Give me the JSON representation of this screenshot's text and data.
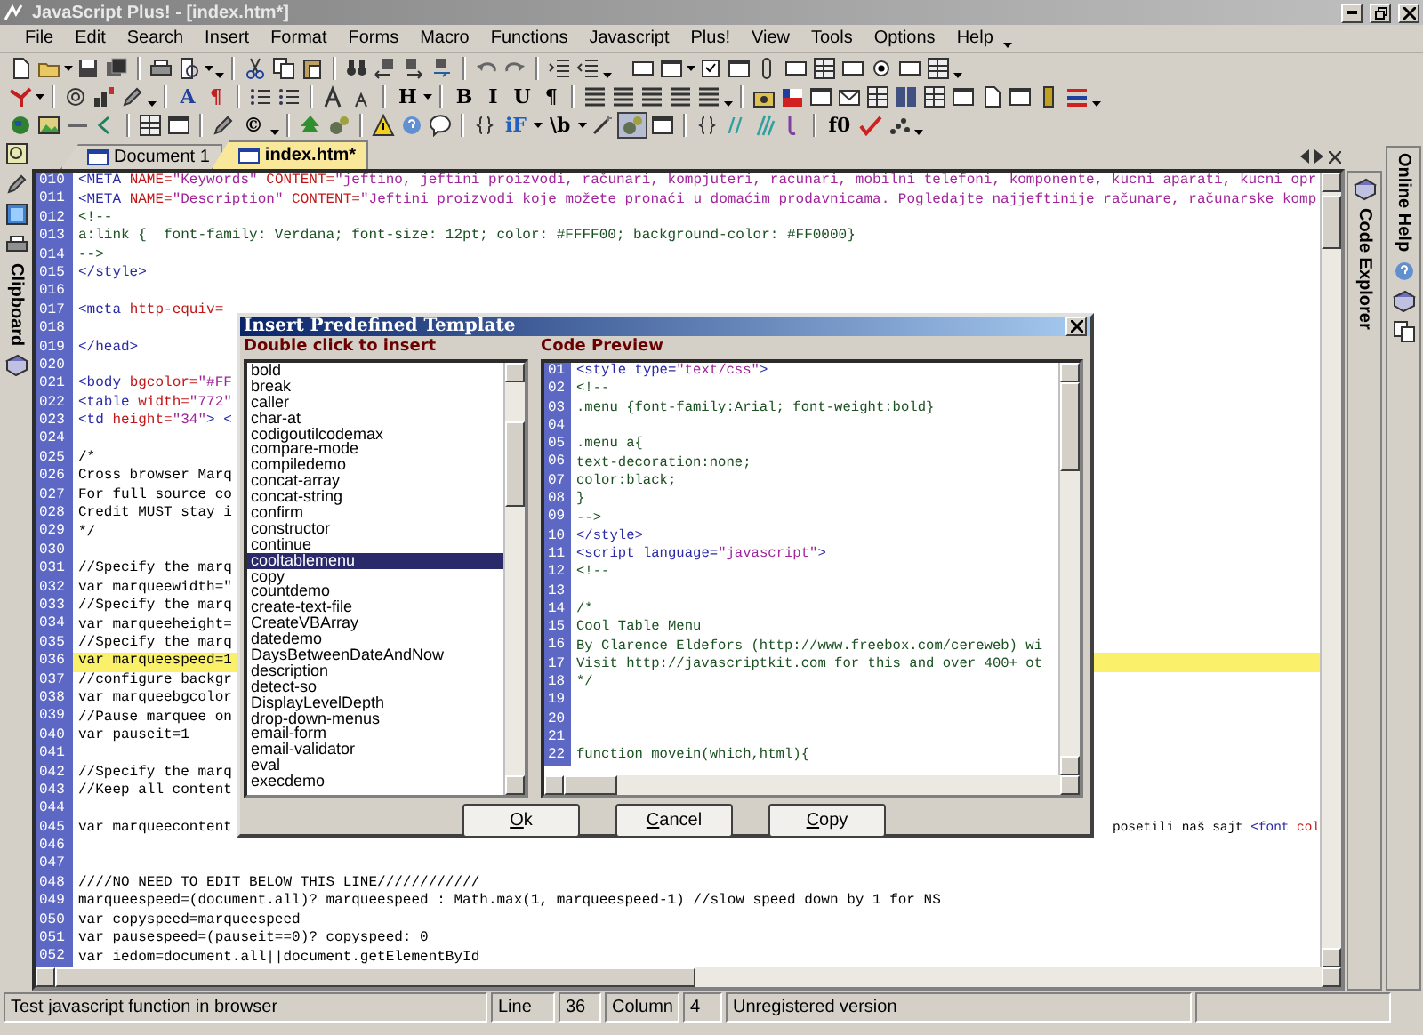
{
  "window": {
    "title": "JavaScript Plus! - [index.htm*]"
  },
  "menu": [
    "File",
    "Edit",
    "Search",
    "Insert",
    "Format",
    "Forms",
    "Macro",
    "Functions",
    "Javascript",
    "Plus!",
    "View",
    "Tools",
    "Options",
    "Help"
  ],
  "toolbars": [
    {
      "labels": [
        "A",
        "¶",
        "H",
        "B",
        "I",
        "U",
        "¶"
      ]
    },
    {
      "labels": [
        "©",
        "iF",
        "\\b",
        "//",
        "f0"
      ]
    }
  ],
  "left_dock": {
    "label": "Clipboard"
  },
  "right_dock": [
    {
      "label": "Code Explorer"
    },
    {
      "label": "Online Help"
    }
  ],
  "tabs": [
    {
      "label": "Document 1",
      "selected": false
    },
    {
      "label": "index.htm*",
      "selected": true
    }
  ],
  "editor": {
    "lines": [
      {
        "number": "010",
        "highlighted": false,
        "segments": [
          {
            "kind": "tag",
            "text": "<META "
          },
          {
            "kind": "attr",
            "text": "NAME="
          },
          {
            "kind": "string",
            "text": "\"Keywords\""
          },
          {
            "kind": "attr",
            "text": " CONTENT="
          },
          {
            "kind": "string",
            "text": "\"jeftino, jeftini proizvodi, računari, kompjuteri, racunari, mobilni telefoni, komponente, kucni aparati, kucni opr"
          }
        ]
      },
      {
        "number": "011",
        "highlighted": false,
        "segments": [
          {
            "kind": "tag",
            "text": "<META "
          },
          {
            "kind": "attr",
            "text": "NAME="
          },
          {
            "kind": "string",
            "text": "\"Description\""
          },
          {
            "kind": "attr",
            "text": " CONTENT="
          },
          {
            "kind": "string",
            "text": "\"Jeftini proizvodi koje možete pronaći u domaćim prodavnicama. Pogledajte najjeftinije računare, računarske komp"
          }
        ]
      },
      {
        "number": "012",
        "highlighted": false,
        "segments": [
          {
            "kind": "css",
            "text": "<!--"
          }
        ]
      },
      {
        "number": "013",
        "highlighted": false,
        "segments": [
          {
            "kind": "css",
            "text": "a:link {  font-family: Verdana; font-size: 12pt; color: #FFFF00; background-color: #FF0000}"
          }
        ]
      },
      {
        "number": "014",
        "highlighted": false,
        "segments": [
          {
            "kind": "css",
            "text": "-->"
          }
        ]
      },
      {
        "number": "015",
        "highlighted": false,
        "segments": [
          {
            "kind": "tag",
            "text": "</style>"
          }
        ]
      },
      {
        "number": "016",
        "highlighted": false
      },
      {
        "number": "017",
        "highlighted": false,
        "segments": [
          {
            "kind": "tag",
            "text": "<meta "
          },
          {
            "kind": "attr",
            "text": "http-equiv="
          }
        ]
      },
      {
        "number": "018",
        "highlighted": false
      },
      {
        "number": "019",
        "highlighted": false,
        "segments": [
          {
            "kind": "tag",
            "text": "</head>"
          }
        ]
      },
      {
        "number": "020",
        "highlighted": false
      },
      {
        "number": "021",
        "highlighted": false,
        "segments": [
          {
            "kind": "tag",
            "text": "<body "
          },
          {
            "kind": "attr",
            "text": "bgcolor="
          },
          {
            "kind": "string",
            "text": "\"#FF"
          }
        ]
      },
      {
        "number": "022",
        "highlighted": false,
        "segments": [
          {
            "kind": "tag",
            "text": "<table "
          },
          {
            "kind": "attr",
            "text": "width="
          },
          {
            "kind": "string",
            "text": "\"772\""
          }
        ]
      },
      {
        "number": "023",
        "highlighted": false,
        "segments": [
          {
            "kind": "tag",
            "text": "<td "
          },
          {
            "kind": "attr",
            "text": "height="
          },
          {
            "kind": "string",
            "text": "\"34\""
          },
          {
            "kind": "tag",
            "text": "> <"
          }
        ]
      },
      {
        "number": "024",
        "highlighted": false
      },
      {
        "number": "025",
        "highlighted": false,
        "segments": [
          {
            "kind": "plain",
            "text": "/*"
          }
        ]
      },
      {
        "number": "026",
        "highlighted": false,
        "segments": [
          {
            "kind": "plain",
            "text": "Cross browser Marq"
          }
        ]
      },
      {
        "number": "027",
        "highlighted": false,
        "segments": [
          {
            "kind": "plain",
            "text": "For full source co"
          }
        ]
      },
      {
        "number": "028",
        "highlighted": false,
        "segments": [
          {
            "kind": "plain",
            "text": "Credit MUST stay i"
          }
        ]
      },
      {
        "number": "029",
        "highlighted": false,
        "segments": [
          {
            "kind": "plain",
            "text": "*/"
          }
        ]
      },
      {
        "number": "030",
        "highlighted": false
      },
      {
        "number": "031",
        "highlighted": false,
        "segments": [
          {
            "kind": "plain",
            "text": "//Specify the marq"
          }
        ]
      },
      {
        "number": "032",
        "highlighted": false,
        "segments": [
          {
            "kind": "plain",
            "text": "var marqueewidth=\""
          }
        ]
      },
      {
        "number": "033",
        "highlighted": false,
        "segments": [
          {
            "kind": "plain",
            "text": "//Specify the marq"
          }
        ]
      },
      {
        "number": "034",
        "highlighted": false,
        "segments": [
          {
            "kind": "plain",
            "text": "var marqueeheight="
          }
        ]
      },
      {
        "number": "035",
        "highlighted": false,
        "segments": [
          {
            "kind": "plain",
            "text": "//Specify the marq"
          }
        ]
      },
      {
        "number": "036",
        "highlighted": true,
        "segments": [
          {
            "kind": "plain",
            "text": "var marqueespeed=1"
          }
        ]
      },
      {
        "number": "037",
        "highlighted": false,
        "segments": [
          {
            "kind": "plain",
            "text": "//configure backgr"
          }
        ]
      },
      {
        "number": "038",
        "highlighted": false,
        "segments": [
          {
            "kind": "plain",
            "text": "var marqueebgcolor"
          }
        ]
      },
      {
        "number": "039",
        "highlighted": false,
        "segments": [
          {
            "kind": "plain",
            "text": "//Pause marquee on"
          }
        ]
      },
      {
        "number": "040",
        "highlighted": false,
        "segments": [
          {
            "kind": "plain",
            "text": "var pauseit=1"
          }
        ]
      },
      {
        "number": "041",
        "highlighted": false
      },
      {
        "number": "042",
        "highlighted": false,
        "segments": [
          {
            "kind": "plain",
            "text": "//Specify the marq"
          }
        ]
      },
      {
        "number": "043",
        "highlighted": false,
        "segments": [
          {
            "kind": "plain",
            "text": "//Keep all content"
          }
        ]
      },
      {
        "number": "044",
        "highlighted": false
      },
      {
        "number": "045",
        "highlighted": false,
        "segments": [
          {
            "kind": "plain",
            "text": "var marqueecontent"
          }
        ],
        "tail": [
          {
            "kind": "plain",
            "text": "posetili naš sajt "
          },
          {
            "kind": "tag",
            "text": "<font "
          },
          {
            "kind": "attr",
            "text": "col"
          }
        ]
      },
      {
        "number": "046",
        "highlighted": false
      },
      {
        "number": "047",
        "highlighted": false
      },
      {
        "number": "048",
        "highlighted": false,
        "segments": [
          {
            "kind": "plain",
            "text": "////NO NEED TO EDIT BELOW THIS LINE////////////"
          }
        ]
      },
      {
        "number": "049",
        "highlighted": false,
        "segments": [
          {
            "kind": "plain",
            "text": "marqueespeed=(document.all)? marqueespeed : Math.max(1, marqueespeed-1) //slow speed down by 1 for NS"
          }
        ]
      },
      {
        "number": "050",
        "highlighted": false,
        "segments": [
          {
            "kind": "plain",
            "text": "var copyspeed=marqueespeed"
          }
        ]
      },
      {
        "number": "051",
        "highlighted": false,
        "segments": [
          {
            "kind": "plain",
            "text": "var pausespeed=(pauseit==0)? copyspeed: 0"
          }
        ]
      },
      {
        "number": "052",
        "highlighted": false,
        "segments": [
          {
            "kind": "plain",
            "text": "var iedom=document.all||document.getElementById"
          }
        ]
      }
    ]
  },
  "dialog": {
    "title": "Insert Predefined Template",
    "list_label": "Double click to insert",
    "items": [
      {
        "label": "bold",
        "selected": false
      },
      {
        "label": "break",
        "selected": false
      },
      {
        "label": "caller",
        "selected": false
      },
      {
        "label": "char-at",
        "selected": false
      },
      {
        "label": "codigoutilcodemax",
        "selected": false
      },
      {
        "label": "compare-mode",
        "selected": false
      },
      {
        "label": "compiledemo",
        "selected": false
      },
      {
        "label": "concat-array",
        "selected": false
      },
      {
        "label": "concat-string",
        "selected": false
      },
      {
        "label": "confirm",
        "selected": false
      },
      {
        "label": "constructor",
        "selected": false
      },
      {
        "label": "continue",
        "selected": false
      },
      {
        "label": "cooltablemenu",
        "selected": true
      },
      {
        "label": "copy",
        "selected": false
      },
      {
        "label": "countdemo",
        "selected": false
      },
      {
        "label": "create-text-file",
        "selected": false
      },
      {
        "label": "CreateVBArray",
        "selected": false
      },
      {
        "label": "datedemo",
        "selected": false
      },
      {
        "label": "DaysBetweenDateAndNow",
        "selected": false
      },
      {
        "label": "description",
        "selected": false
      },
      {
        "label": "detect-so",
        "selected": false
      },
      {
        "label": "DisplayLevelDepth",
        "selected": false
      },
      {
        "label": "drop-down-menus",
        "selected": false
      },
      {
        "label": "email-form",
        "selected": false
      },
      {
        "label": "email-validator",
        "selected": false
      },
      {
        "label": "eval",
        "selected": false
      },
      {
        "label": "execdemo",
        "selected": false
      }
    ],
    "preview_label": "Code Preview",
    "preview": [
      {
        "number": "01",
        "segments": [
          {
            "kind": "tag",
            "text": "<style "
          },
          {
            "kind": "tag",
            "text": "type="
          },
          {
            "kind": "string",
            "text": "\"text/css\""
          },
          {
            "kind": "tag",
            "text": ">"
          }
        ]
      },
      {
        "number": "02",
        "segments": [
          {
            "kind": "css",
            "text": "<!--"
          }
        ]
      },
      {
        "number": "03",
        "segments": [
          {
            "kind": "css",
            "text": ".menu {font-family:Arial; font-weight:bold}"
          }
        ]
      },
      {
        "number": "04"
      },
      {
        "number": "05",
        "segments": [
          {
            "kind": "css",
            "text": ".menu a{"
          }
        ]
      },
      {
        "number": "06",
        "segments": [
          {
            "kind": "css",
            "text": "text-decoration:none;"
          }
        ]
      },
      {
        "number": "07",
        "segments": [
          {
            "kind": "css",
            "text": "color:black;"
          }
        ]
      },
      {
        "number": "08",
        "segments": [
          {
            "kind": "css",
            "text": "}"
          }
        ]
      },
      {
        "number": "09",
        "segments": [
          {
            "kind": "css",
            "text": "-->"
          }
        ]
      },
      {
        "number": "10",
        "segments": [
          {
            "kind": "tag",
            "text": "</style>"
          }
        ]
      },
      {
        "number": "11",
        "segments": [
          {
            "kind": "tag",
            "text": "<script "
          },
          {
            "kind": "tag",
            "text": "language="
          },
          {
            "kind": "string",
            "text": "\"javascript\""
          },
          {
            "kind": "tag",
            "text": ">"
          }
        ]
      },
      {
        "number": "12",
        "segments": [
          {
            "kind": "css",
            "text": "<!--"
          }
        ]
      },
      {
        "number": "13"
      },
      {
        "number": "14",
        "segments": [
          {
            "kind": "css",
            "text": "/*"
          }
        ]
      },
      {
        "number": "15",
        "segments": [
          {
            "kind": "css",
            "text": "Cool Table Menu"
          }
        ]
      },
      {
        "number": "16",
        "segments": [
          {
            "kind": "css",
            "text": "By Clarence Eldefors (http://www.freebox.com/cereweb) wi"
          }
        ]
      },
      {
        "number": "17",
        "segments": [
          {
            "kind": "css",
            "text": "Visit http://javascriptkit.com for this and over 400+ ot"
          }
        ]
      },
      {
        "number": "18",
        "segments": [
          {
            "kind": "css",
            "text": "*/"
          }
        ]
      },
      {
        "number": "19"
      },
      {
        "number": "20"
      },
      {
        "number": "21"
      },
      {
        "number": "22",
        "segments": [
          {
            "kind": "css",
            "text": "function movein(which,html){"
          }
        ]
      }
    ],
    "buttons": [
      "Ok",
      "Cancel",
      "Copy"
    ]
  },
  "status_bar": {
    "message": "Test javascript function in browser",
    "line_label": "Line",
    "line": "36",
    "column_label": "Column",
    "column": "4",
    "license": "Unregistered version"
  }
}
